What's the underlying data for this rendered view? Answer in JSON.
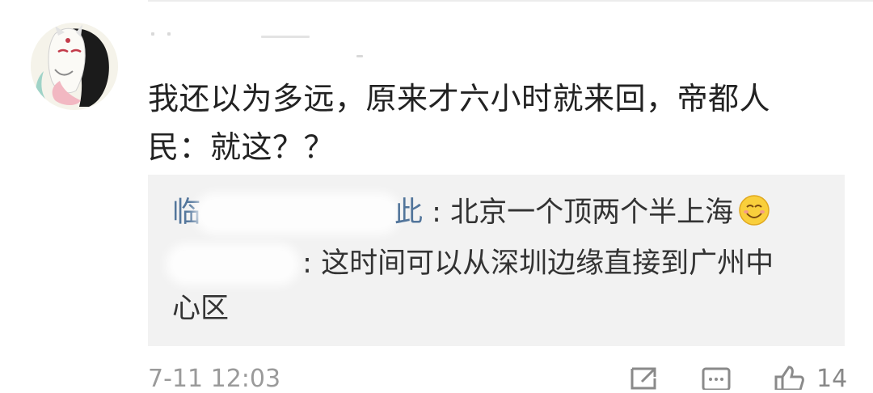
{
  "comment": {
    "text": "我还以为多远，原来才六小时就来回，帝都人民：就这？？",
    "timestamp": "7-11 12:03",
    "like_count": "14"
  },
  "replies": [
    {
      "name_visible_start": "临",
      "name_visible_end": "此",
      "separator": ": ",
      "text": "北京一个顶两个半上海",
      "emoji": "smile-emoji"
    },
    {
      "name_visible_end": "",
      "separator": ": ",
      "text": "这时间可以从深圳边缘直接到广州中",
      "continuation": "心区"
    }
  ],
  "icons": {
    "share": "share-icon",
    "comment": "comment-icon",
    "like": "like-icon"
  },
  "colors": {
    "link_name": "#52759b",
    "reply_bg": "#f2f2f2",
    "meta_gray": "#9a9a9a"
  }
}
